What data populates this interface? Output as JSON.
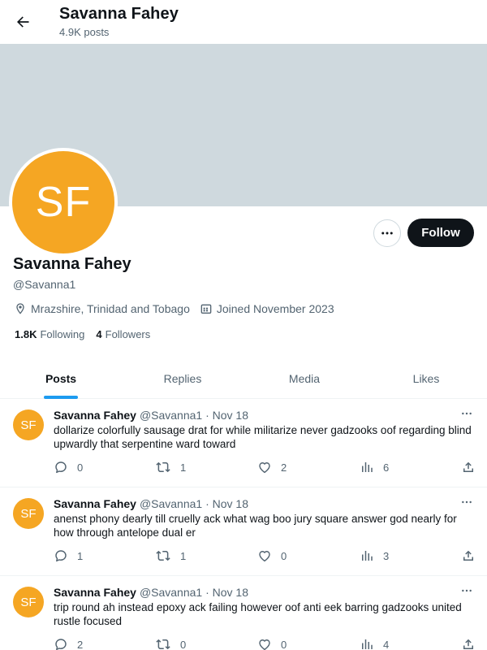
{
  "header": {
    "name": "Savanna Fahey",
    "post_count": "4.9K posts"
  },
  "profile": {
    "initials": "SF",
    "name": "Savanna Fahey",
    "handle": "@Savanna1",
    "location": "Mrazshire, Trinidad and Tobago",
    "joined": "Joined November 2023",
    "following_count": "1.8K",
    "following_label": "Following",
    "followers_count": "4",
    "followers_label": "Followers",
    "follow_label": "Follow",
    "avatar_color": "#f5a623",
    "banner_color": "#cfd9de"
  },
  "tabs": [
    {
      "label": "Posts",
      "active": true
    },
    {
      "label": "Replies",
      "active": false
    },
    {
      "label": "Media",
      "active": false
    },
    {
      "label": "Likes",
      "active": false
    }
  ],
  "posts": [
    {
      "initials": "SF",
      "name": "Savanna Fahey",
      "meta": "@Savanna1 · Nov 18",
      "text": "dollarize colorfully sausage drat for while militarize never gadzooks oof regarding blind upwardly that serpentine ward toward",
      "replies": "0",
      "reposts": "1",
      "likes": "2",
      "views": "6"
    },
    {
      "initials": "SF",
      "name": "Savanna Fahey",
      "meta": "@Savanna1 · Nov 18",
      "text": "anenst phony dearly till cruelly ack what wag boo jury square answer god nearly for how through antelope dual er",
      "replies": "1",
      "reposts": "1",
      "likes": "0",
      "views": "3"
    },
    {
      "initials": "SF",
      "name": "Savanna Fahey",
      "meta": "@Savanna1 · Nov 18",
      "text": "trip round ah instead epoxy ack failing however oof anti eek barring gadzooks united rustle focused",
      "replies": "2",
      "reposts": "0",
      "likes": "0",
      "views": "4"
    }
  ]
}
